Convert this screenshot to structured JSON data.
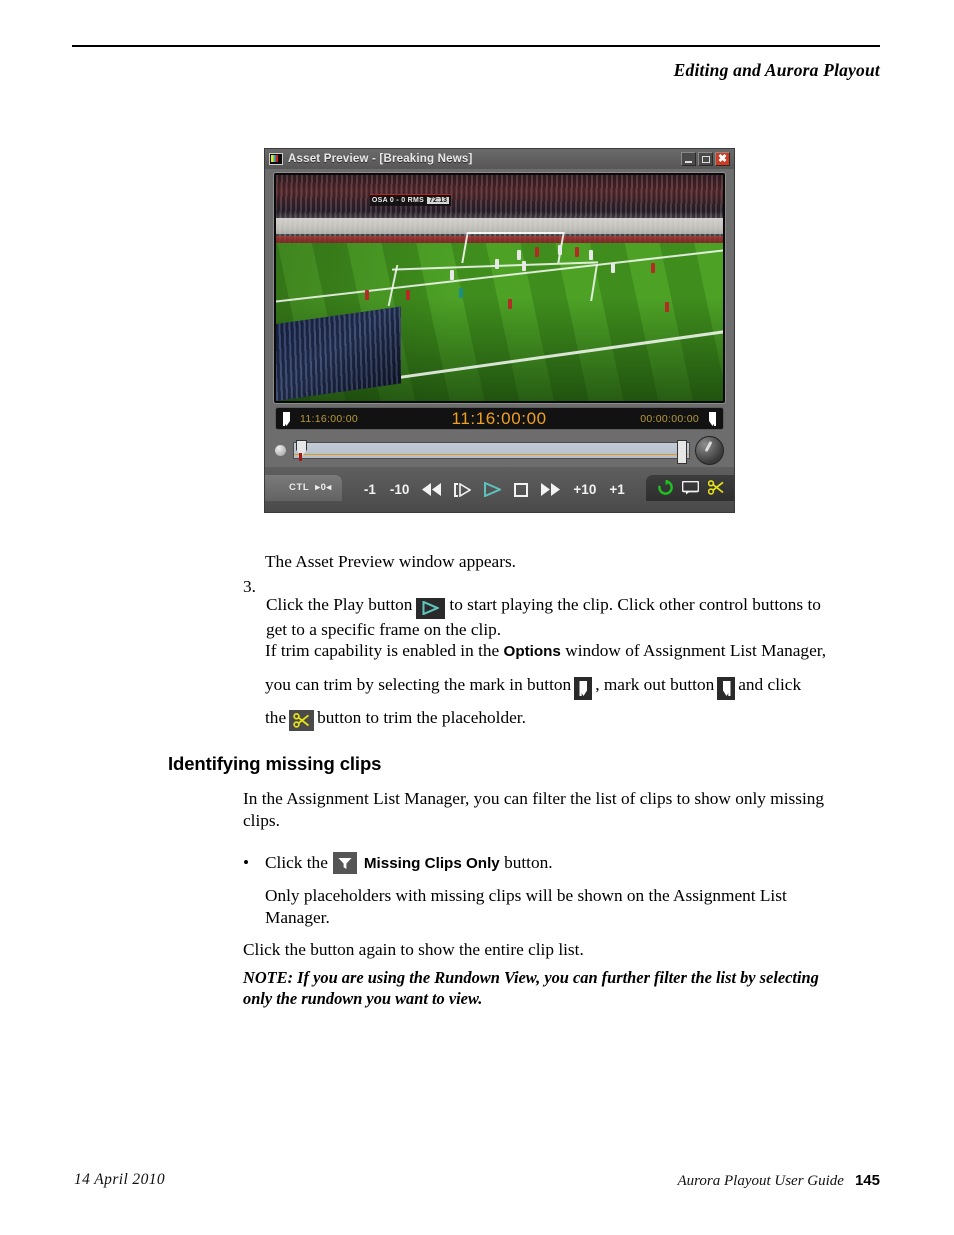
{
  "header": {
    "title": "Editing and Aurora Playout"
  },
  "footer": {
    "date": "14 April 2010",
    "guide": "Aurora Playout User Guide",
    "page": "145"
  },
  "figure": {
    "window_title": "Asset Preview - [Breaking News]",
    "window_icon": "monitor-icon",
    "titlebar_buttons": {
      "minimize": "minimize-icon",
      "maximize": "maximize-icon",
      "close": "close-icon"
    },
    "video": {
      "scorebug_teams": "OSA 0 - 0 RMS",
      "scorebug_clock": "72:13"
    },
    "timecode": {
      "mark_in_icon": "mark-in-icon",
      "in_point": "11:16:00:00",
      "current": "11:16:00:00",
      "duration": "00:00:00:00",
      "mark_out_icon": "mark-out-icon"
    },
    "transport": {
      "ctl_label": "CTL",
      "ctl_value": "0",
      "buttons": [
        {
          "name": "minus-one-button",
          "label": "-1"
        },
        {
          "name": "minus-ten-button",
          "label": "-10"
        },
        {
          "name": "rewind-button",
          "label": ""
        },
        {
          "name": "cue-play-button",
          "label": ""
        },
        {
          "name": "play-button",
          "label": ""
        },
        {
          "name": "stop-button",
          "label": ""
        },
        {
          "name": "fast-forward-button",
          "label": ""
        },
        {
          "name": "plus-ten-button",
          "label": "+10"
        },
        {
          "name": "plus-one-button",
          "label": "+1"
        }
      ],
      "right_buttons": [
        {
          "name": "loop-icon",
          "label": ""
        },
        {
          "name": "monitor-icon",
          "label": ""
        },
        {
          "name": "scissors-icon",
          "label": ""
        }
      ]
    },
    "colors": {
      "timecode_amber": "#f0a020",
      "play_teal": "#5fc3bd",
      "scissors_yellow": "#e8e215",
      "loop_green": "#1fc01f",
      "close_red": "#cf3a20"
    }
  },
  "body": {
    "caption": "The Asset Preview window appears.",
    "step3": {
      "number": "3.",
      "part1": "Click the Play button",
      "part2": "to start playing the clip. Click other control buttons to get to a specific frame on the clip."
    },
    "trim": {
      "line1_a": "If trim capability is enabled in the",
      "line1_bold": "Options",
      "line1_b": "window of Assignment List Manager,",
      "line2_a": "you can trim by selecting the mark in button",
      "line2_b": ", mark out button",
      "line2_c": "and click",
      "line3_a": "the",
      "line3_b": "button to trim the placeholder."
    },
    "heading": "Identifying missing clips",
    "section_intro": "In the Assignment List Manager, you can filter the list of clips to show only missing clips.",
    "bullet": {
      "dot": "•",
      "pre": "Click the",
      "bold": "Missing Clips Only",
      "post": "button."
    },
    "after_bullet": "Only placeholders with missing clips will be shown on the Assignment List Manager.",
    "click_again": "Click the button again to show the entire clip list.",
    "note": "NOTE:  If you are using the Rundown View, you can further filter the list by selecting only the rundown you want to view."
  }
}
